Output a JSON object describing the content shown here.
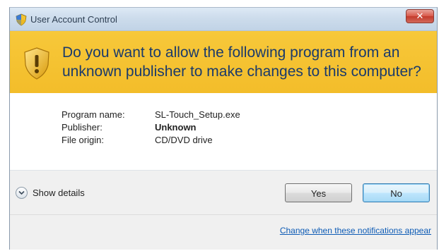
{
  "window": {
    "title": "User Account Control",
    "close_label": "✕"
  },
  "banner": {
    "question_line1": "Do you want to allow the following program from an",
    "question_line2": "unknown publisher to make changes to this computer?"
  },
  "details": {
    "program_name_label": "Program name:",
    "program_name_value": "SL-Touch_Setup.exe",
    "publisher_label": "Publisher:",
    "publisher_value": "Unknown",
    "file_origin_label": "File origin:",
    "file_origin_value": "CD/DVD drive"
  },
  "footer": {
    "show_details_label": "Show details",
    "yes_label": "Yes",
    "no_label": "No",
    "notifications_link": "Change when these notifications appear"
  },
  "colors": {
    "banner": "#f5c12f",
    "question_text": "#1a3a6b",
    "link": "#0d5bb5",
    "close_button": "#d8584a"
  },
  "icons": {
    "title": "uac-shield-icon",
    "banner": "warning-shield-icon",
    "expand": "chevron-down-icon"
  }
}
